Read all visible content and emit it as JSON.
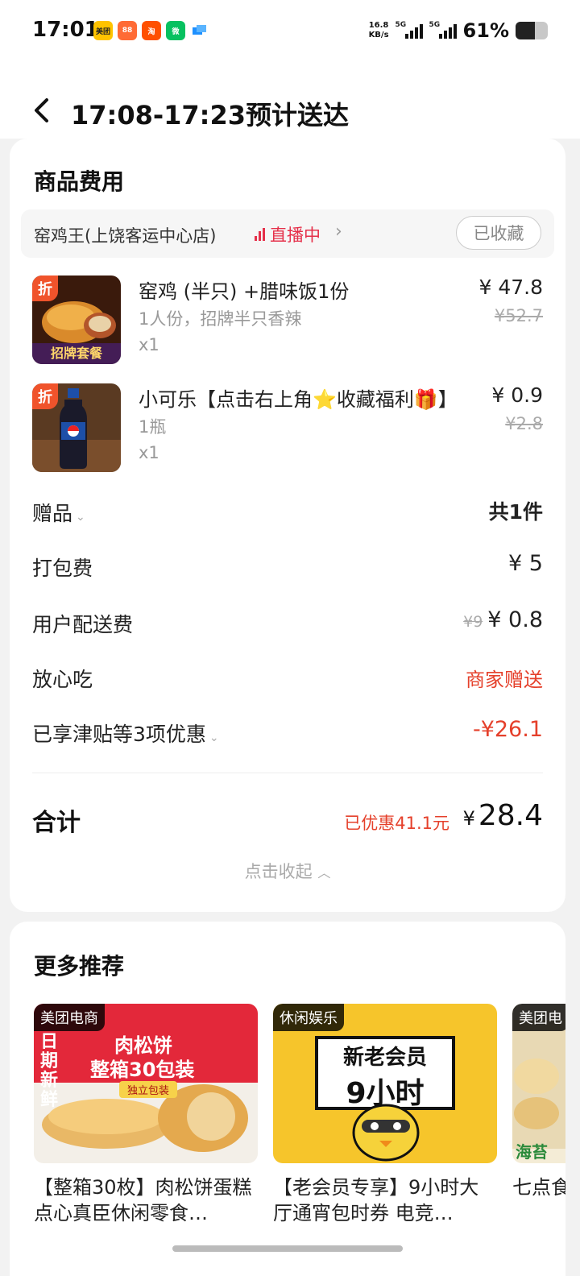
{
  "status": {
    "time": "17:01",
    "apps": [
      {
        "icon": "meituan-app-icon",
        "text": "美团",
        "color": "#ffc300"
      },
      {
        "icon": "app-icon-orange",
        "text": "88",
        "color": "#ff6b35"
      },
      {
        "icon": "taobao-app-icon",
        "text": "淘",
        "color": "#ff5000"
      },
      {
        "icon": "wechat-app-icon",
        "text": "微",
        "color": "#07c160"
      },
      {
        "icon": "app-icon-blue",
        "text": "",
        "color": "#1e90ff"
      }
    ],
    "speed_value": "16.8",
    "speed_unit": "KB/s",
    "net1": "5G",
    "net2": "5G",
    "battery_pct": "61%",
    "battery_level": 0.61
  },
  "header": {
    "title": "17:08-17:23预计送达"
  },
  "fees": {
    "section_title": "商品费用",
    "store": {
      "name": "窑鸡王(上饶客运中心店)",
      "live_label": "直播中",
      "fav_label": "已收藏"
    },
    "items": [
      {
        "name": "窑鸡 (半只) +腊味饭1份",
        "spec": "1人份，招牌半只香辣",
        "qty": "x1",
        "price": "¥ 47.8",
        "orig": "¥52.7",
        "badge": "折",
        "thumb_label": "招牌套餐"
      },
      {
        "name": "小可乐【点击右上角⭐收藏福利🎁】",
        "spec": "1瓶",
        "qty": "x1",
        "price": "¥ 0.9",
        "orig": "¥2.8",
        "badge": "折"
      }
    ],
    "gift": {
      "label": "赠品",
      "value": "共1件"
    },
    "packing": {
      "label": "打包费",
      "value": "¥ 5"
    },
    "delivery": {
      "label": "用户配送费",
      "orig": "¥9",
      "value": "¥ 0.8"
    },
    "assurance": {
      "label": "放心吃",
      "value": "商家赠送"
    },
    "discounts": {
      "label": "已享津贴等3项优惠",
      "value": "-¥26.1"
    },
    "total": {
      "label": "合计",
      "saved": "已优惠41.1元",
      "currency": "¥",
      "value": "28.4"
    },
    "collapse_label": "点击收起"
  },
  "recommend": {
    "title": "更多推荐",
    "cards": [
      {
        "tag": "美团电商",
        "banner_line1": "肉松饼",
        "banner_line2": "整箱30包装",
        "banner_sub": "独立包装",
        "banner_side": "日期新鲜",
        "desc": "【整箱30枚】肉松饼蛋糕点心真臣休闲零食…"
      },
      {
        "tag": "休闲娱乐",
        "banner_line1": "新老会员",
        "banner_line2": "9小时",
        "desc": "【老会员专享】9小时大厅通宵包时券 电竞…"
      },
      {
        "tag": "美团电",
        "banner_bottom": "海苔",
        "desc": "七点食米果大"
      }
    ]
  }
}
